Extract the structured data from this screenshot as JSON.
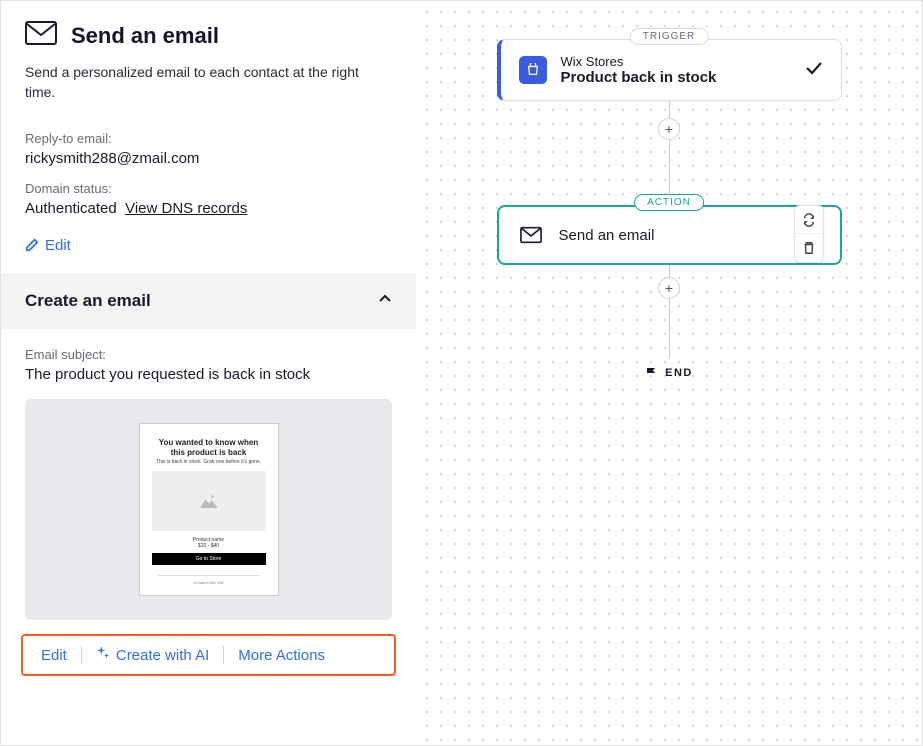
{
  "header": {
    "title": "Send an email",
    "description": "Send a personalized email to each contact at the right time."
  },
  "details": {
    "reply_to_label": "Reply-to email:",
    "reply_to_value": "rickysmith288@zmail.com",
    "domain_status_label": "Domain status:",
    "domain_status_value": "Authenticated",
    "dns_link": "View DNS records",
    "edit_label": "Edit"
  },
  "accordion": {
    "title": "Create an email"
  },
  "email": {
    "subject_label": "Email subject:",
    "subject_value": "The product you requested is back in stock",
    "preview": {
      "headline": "You wanted to know when this product is back",
      "cta": "Go to Store"
    }
  },
  "actions": {
    "edit": "Edit",
    "create_ai": "Create with AI",
    "more": "More Actions"
  },
  "flow": {
    "trigger_badge": "TRIGGER",
    "trigger_source": "Wix Stores",
    "trigger_event": "Product back in stock",
    "action_badge": "ACTION",
    "action_title": "Send an email",
    "end_label": "END"
  }
}
